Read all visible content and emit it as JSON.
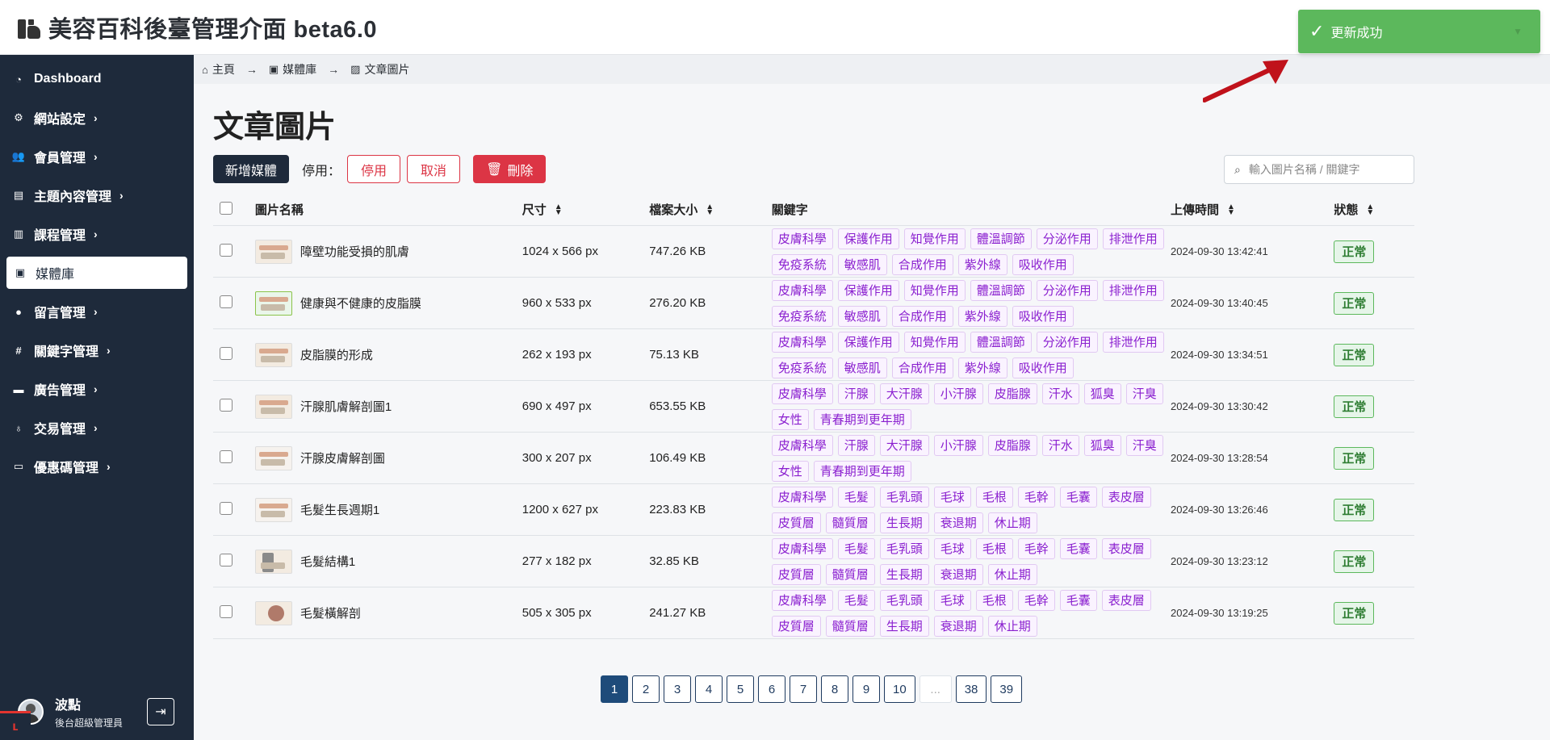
{
  "app": {
    "title": "美容百科後臺管理介面 beta6.0"
  },
  "sidebar": {
    "items": [
      {
        "label": "Dashboard",
        "icon": "dashboard-icon",
        "chevron": ""
      },
      {
        "label": "網站設定",
        "icon": "gear-icon",
        "chevron": "›"
      },
      {
        "label": "會員管理",
        "icon": "users-icon",
        "chevron": "›"
      },
      {
        "label": "主題內容管理",
        "icon": "content-icon",
        "chevron": "›"
      },
      {
        "label": "課程管理",
        "icon": "book-icon",
        "chevron": "›"
      },
      {
        "label": "媒體庫",
        "icon": "images-icon",
        "chevron": ""
      },
      {
        "label": "留言管理",
        "icon": "comment-icon",
        "chevron": "›"
      },
      {
        "label": "關鍵字管理",
        "icon": "hashtag-icon",
        "chevron": "›"
      },
      {
        "label": "廣告管理",
        "icon": "ad-icon",
        "chevron": "›"
      },
      {
        "label": "交易管理",
        "icon": "money-bag-icon",
        "chevron": "›"
      },
      {
        "label": "優惠碼管理",
        "icon": "ticket-icon",
        "chevron": "›"
      }
    ],
    "active_index": 5,
    "user": {
      "name": "波點",
      "role": "後台超級管理員"
    }
  },
  "breadcrumb": {
    "items": [
      {
        "label": "主頁",
        "icon": "home-icon"
      },
      {
        "label": "媒體庫",
        "icon": "images-icon"
      },
      {
        "label": "文章圖片",
        "icon": "image-icon"
      }
    ]
  },
  "main": {
    "title": "文章圖片",
    "toolbar": {
      "add_label": "新增媒體",
      "disable_label": "停用：",
      "disable_btn": "停用",
      "cancel_btn": "取消",
      "delete_btn": "刪除"
    },
    "search": {
      "placeholder": "輸入圖片名稱 / 關鍵字"
    },
    "table": {
      "headers": {
        "name": "圖片名稱",
        "size": "尺寸",
        "file_size": "檔案大小",
        "keywords": "關鍵字",
        "uploaded": "上傳時間",
        "status": "狀態"
      },
      "rows": [
        {
          "name": "障壁功能受損的肌膚",
          "size": "1024 x 566 px",
          "file_size": "747.26 KB",
          "keywords": [
            "皮膚科學",
            "保護作用",
            "知覺作用",
            "體溫調節",
            "分泌作用",
            "排泄作用",
            "免疫系統",
            "敏感肌",
            "合成作用",
            "紫外線",
            "吸收作用"
          ],
          "uploaded": "2024-09-30 13:42:41",
          "status": "正常",
          "thumb": ""
        },
        {
          "name": "健康與不健康的皮脂膜",
          "size": "960 x 533 px",
          "file_size": "276.20 KB",
          "keywords": [
            "皮膚科學",
            "保護作用",
            "知覺作用",
            "體溫調節",
            "分泌作用",
            "排泄作用",
            "免疫系統",
            "敏感肌",
            "合成作用",
            "紫外線",
            "吸收作用"
          ],
          "uploaded": "2024-09-30 13:40:45",
          "status": "正常",
          "thumb": "green"
        },
        {
          "name": "皮脂膜的形成",
          "size": "262 x 193 px",
          "file_size": "75.13 KB",
          "keywords": [
            "皮膚科學",
            "保護作用",
            "知覺作用",
            "體溫調節",
            "分泌作用",
            "排泄作用",
            "免疫系統",
            "敏感肌",
            "合成作用",
            "紫外線",
            "吸收作用"
          ],
          "uploaded": "2024-09-30 13:34:51",
          "status": "正常",
          "thumb": ""
        },
        {
          "name": "汗腺肌膚解剖圖1",
          "size": "690 x 497 px",
          "file_size": "653.55 KB",
          "keywords": [
            "皮膚科學",
            "汗腺",
            "大汗腺",
            "小汗腺",
            "皮脂腺",
            "汗水",
            "狐臭",
            "汗臭",
            "女性",
            "青春期到更年期"
          ],
          "uploaded": "2024-09-30 13:30:42",
          "status": "正常",
          "thumb": ""
        },
        {
          "name": "汗腺皮膚解剖圖",
          "size": "300 x 207 px",
          "file_size": "106.49 KB",
          "keywords": [
            "皮膚科學",
            "汗腺",
            "大汗腺",
            "小汗腺",
            "皮脂腺",
            "汗水",
            "狐臭",
            "汗臭",
            "女性",
            "青春期到更年期"
          ],
          "uploaded": "2024-09-30 13:28:54",
          "status": "正常",
          "thumb": "alt"
        },
        {
          "name": "毛髮生長週期1",
          "size": "1200 x 627 px",
          "file_size": "223.83 KB",
          "keywords": [
            "皮膚科學",
            "毛髮",
            "毛乳頭",
            "毛球",
            "毛根",
            "毛幹",
            "毛囊",
            "表皮層",
            "皮質層",
            "髓質層",
            "生長期",
            "衰退期",
            "休止期"
          ],
          "uploaded": "2024-09-30 13:26:46",
          "status": "正常",
          "thumb": "alt"
        },
        {
          "name": "毛髮結構1",
          "size": "277 x 182 px",
          "file_size": "32.85 KB",
          "keywords": [
            "皮膚科學",
            "毛髮",
            "毛乳頭",
            "毛球",
            "毛根",
            "毛幹",
            "毛囊",
            "表皮層",
            "皮質層",
            "髓質層",
            "生長期",
            "衰退期",
            "休止期"
          ],
          "uploaded": "2024-09-30 13:23:12",
          "status": "正常",
          "thumb": "dark"
        },
        {
          "name": "毛髮橫解剖",
          "size": "505 x 305 px",
          "file_size": "241.27 KB",
          "keywords": [
            "皮膚科學",
            "毛髮",
            "毛乳頭",
            "毛球",
            "毛根",
            "毛幹",
            "毛囊",
            "表皮層",
            "皮質層",
            "髓質層",
            "生長期",
            "衰退期",
            "休止期"
          ],
          "uploaded": "2024-09-30 13:19:25",
          "status": "正常",
          "thumb": "round"
        }
      ]
    },
    "pagination": {
      "pages": [
        "1",
        "2",
        "3",
        "4",
        "5",
        "6",
        "7",
        "8",
        "9",
        "10",
        "...",
        "38",
        "39"
      ],
      "current": "1"
    }
  },
  "toast": {
    "message": "更新成功"
  },
  "colors": {
    "sidebar_bg": "#1e2a3b",
    "primary": "#1e2a3b",
    "danger": "#dc3545",
    "tag_text": "#8a1fcf",
    "success": "#5cb85c",
    "annotation_arrow": "#c0121b"
  }
}
